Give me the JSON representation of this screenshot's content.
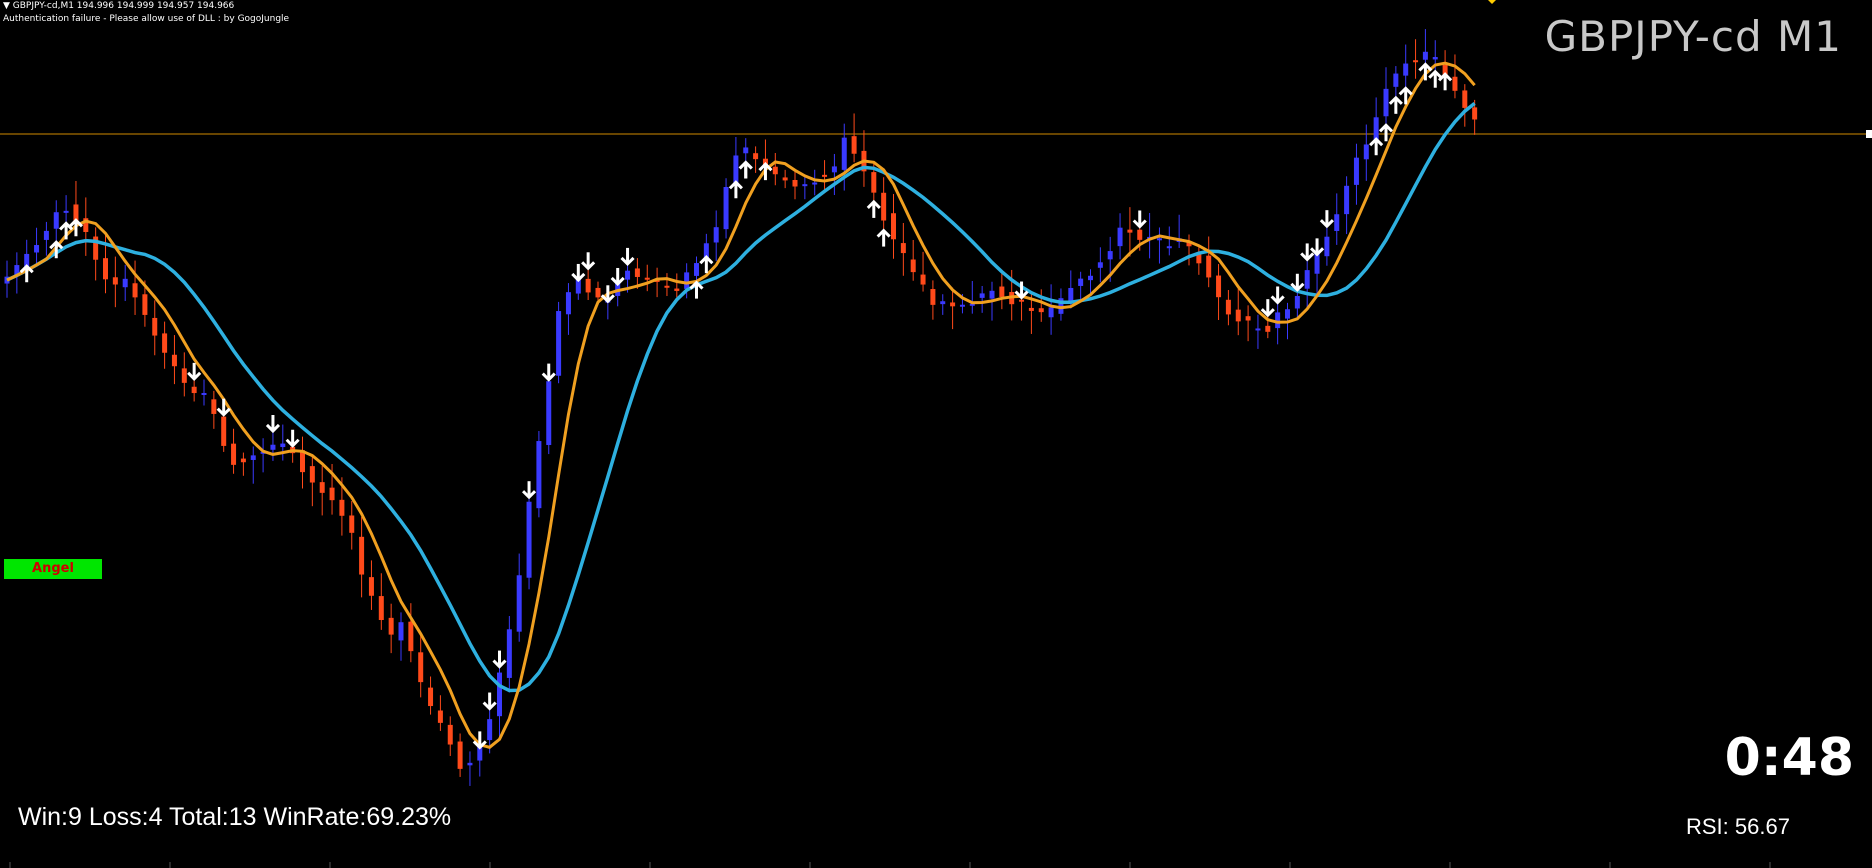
{
  "chart_header": {
    "line1": "▼ GBPJPY-cd,M1  194.996 194.999 194.957 194.966",
    "line2": "Authentication failure - Please allow use of DLL : by GogoJungle"
  },
  "symbol_title": "GBPJPY-cd M1",
  "angel_button_label": "Angel",
  "countdown": "0:48",
  "stats": "Win:9 Loss:4 Total:13 WinRate:69.23%",
  "rsi": "RSI: 56.67",
  "colors": {
    "background": "#000000",
    "bull_candle": "#3a3aff",
    "bear_candle": "#ff4a1a",
    "fast_ma": "#f0a020",
    "slow_ma": "#2eb0e0",
    "price_line": "#d08a00",
    "arrow": "#ffffff",
    "angel_bg": "#00e600",
    "angel_text": "#d00000"
  },
  "chart_data": {
    "type": "candlestick",
    "price_line_level": 194.966,
    "series": [
      {
        "name": "candles",
        "count": 150
      },
      {
        "name": "fast_ma"
      },
      {
        "name": "slow_ma"
      }
    ],
    "up_arrow_candles": [
      2,
      5,
      6,
      7,
      70,
      71,
      74,
      75,
      75,
      77,
      88,
      89,
      139,
      140,
      141,
      142,
      144,
      145,
      146
    ],
    "down_arrow_candles": [
      19,
      22,
      27,
      29,
      48,
      49,
      50,
      53,
      55,
      58,
      59,
      61,
      62,
      63,
      103,
      115,
      128,
      129,
      131,
      132,
      133,
      134
    ]
  }
}
